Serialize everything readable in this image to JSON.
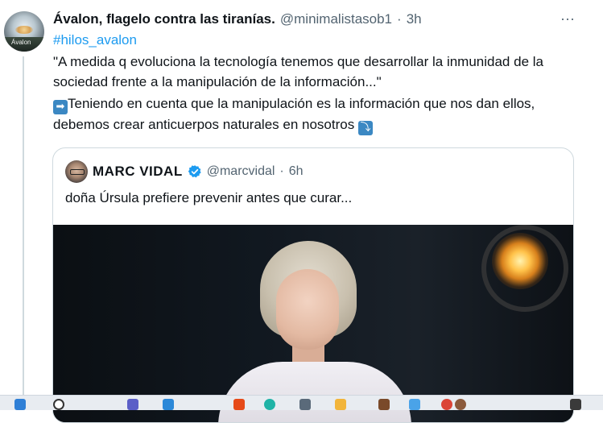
{
  "tweet": {
    "author_avatar_text": "Ávalon",
    "author_name": "Ávalon, flagelo contra las tiranías.",
    "handle": "@minimalistasob1",
    "separator": "·",
    "time": "3h",
    "more": "···",
    "hashtag": "#hilos_avalon",
    "text_line1": "\"A medida q evoluciona la tecnología tenemos que desarrollar la inmunidad de la sociedad frente a la manipulación de la información...\"",
    "arrow_emoji": "➡",
    "text_line2": "Teniendo en cuenta que la manipulación es la información que nos dan ellos, debemos crear anticuerpos naturales en nosotros",
    "down_emoji": "⤵"
  },
  "quote": {
    "name": "MARC VIDAL",
    "handle": "@marcvidal",
    "separator": "·",
    "time": "6h",
    "text": "doña Úrsula prefiere prevenir antes que curar..."
  },
  "colors": {
    "link": "#1d9bf0",
    "muted": "#536471",
    "text": "#0f1419",
    "border": "#cfd9de"
  },
  "icons": [
    "more-options-icon",
    "verified-badge-icon",
    "arrow-right-emoji-icon",
    "arrow-down-emoji-icon"
  ]
}
